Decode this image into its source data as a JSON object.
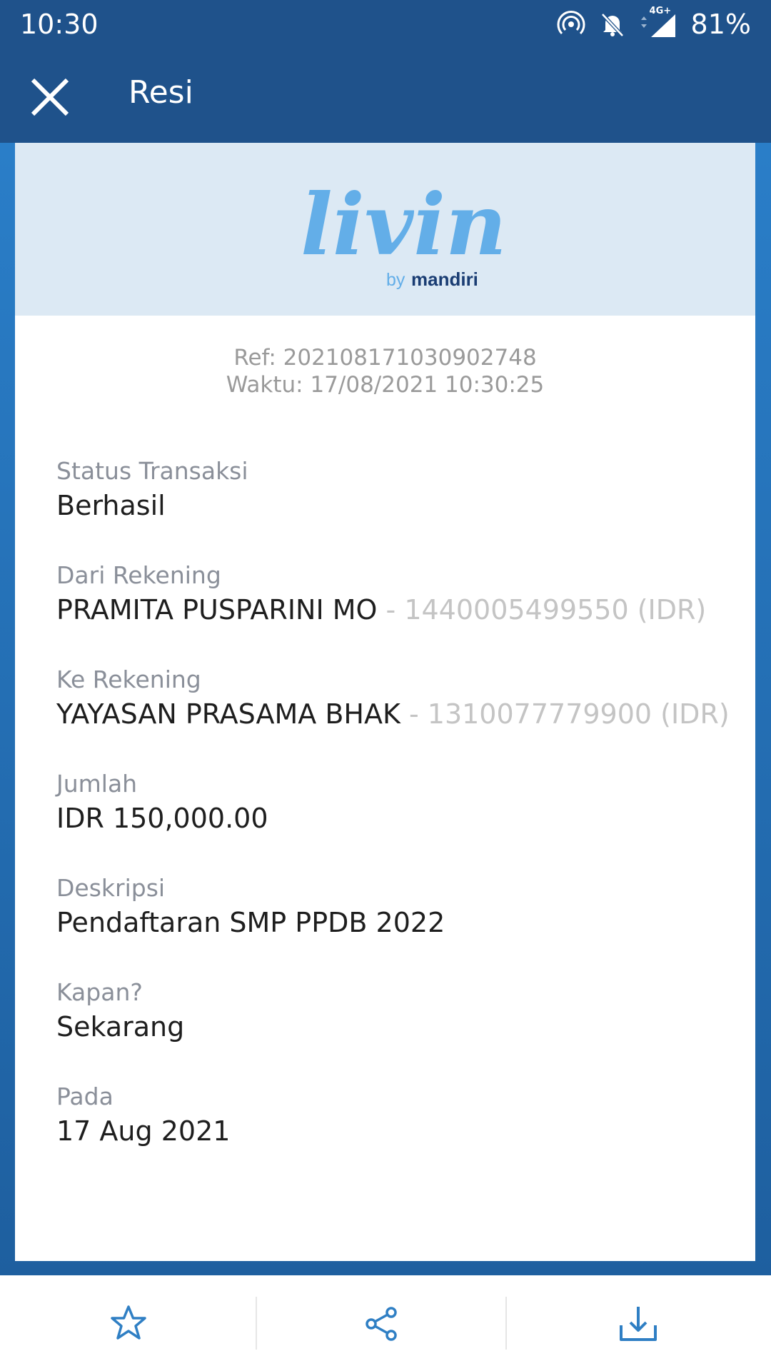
{
  "status_bar": {
    "time": "10:30",
    "network": "4G+",
    "battery": "81%",
    "icons": [
      "hotspot-icon",
      "bell-muted-icon",
      "signal-icon"
    ]
  },
  "app_bar": {
    "title": "Resi",
    "close_icon": "close-icon"
  },
  "receipt": {
    "logo": {
      "brand": "livin'",
      "sub_prefix": "by",
      "sub": "mandiri"
    },
    "ref": "Ref: 20210817103090274​8",
    "time": "Waktu: 17/08/2021 10:30:25",
    "fields": [
      {
        "label": "Status Transaksi",
        "value": "Berhasil",
        "suffix": ""
      },
      {
        "label": "Dari Rekening",
        "value": "PRAMITA PUSPARINI MO",
        "suffix": " - 1440005499550 (IDR)"
      },
      {
        "label": "Ke Rekening",
        "value": "YAYASAN PRASAMA BHAK",
        "suffix": " - 1310077779900 (IDR)"
      },
      {
        "label": "Jumlah",
        "value": "IDR 150,000.00",
        "suffix": ""
      },
      {
        "label": "Deskripsi",
        "value": "Pendaftaran SMP PPDB 2022",
        "suffix": ""
      },
      {
        "label": "Kapan?",
        "value": "Sekarang",
        "suffix": ""
      },
      {
        "label": "Pada",
        "value": "17 Aug 2021",
        "suffix": ""
      }
    ]
  },
  "bottom_bar": {
    "icons": [
      "star-icon",
      "share-icon",
      "download-icon"
    ]
  },
  "colors": {
    "app_bar": "#1f528b",
    "accent": "#2a7ec8",
    "logo_blue": "#63aee8",
    "logo_dark": "#1a3d73",
    "logo_yellow": "#f2b500"
  }
}
